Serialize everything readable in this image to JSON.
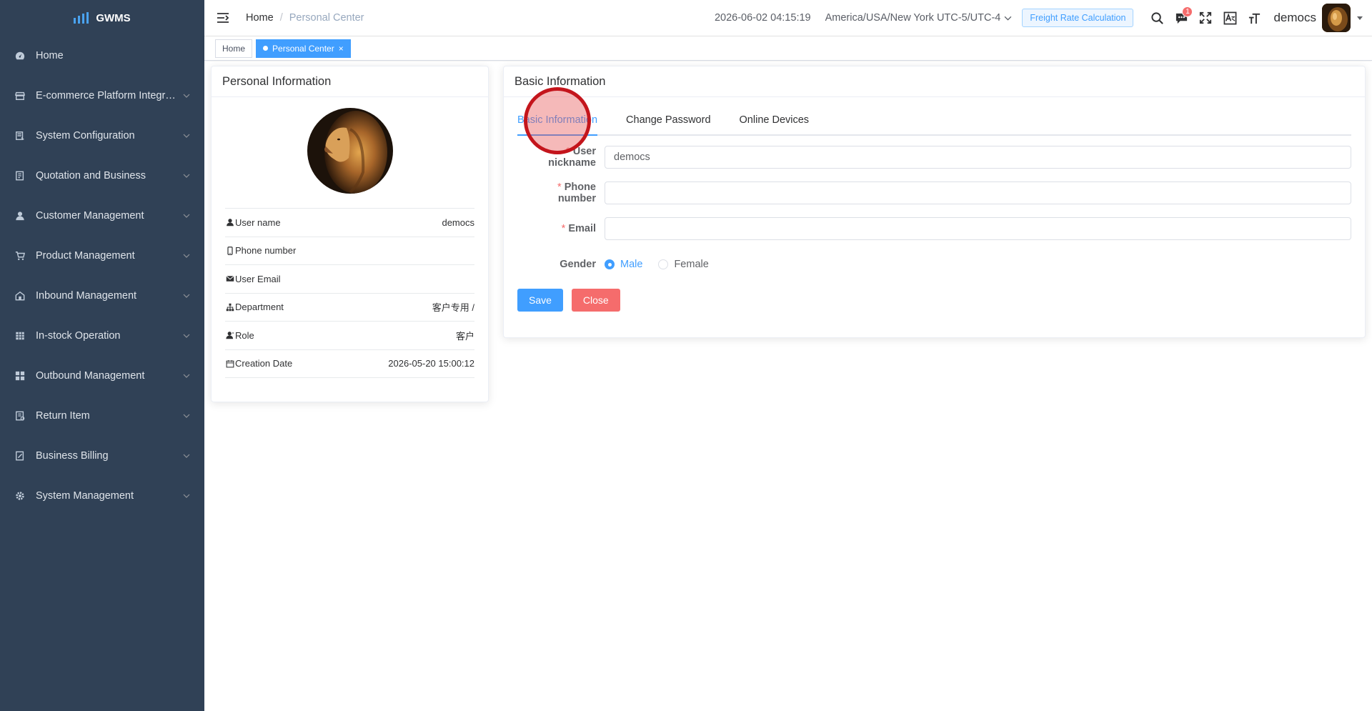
{
  "app": {
    "name": "GWMS"
  },
  "sidebar": {
    "items": [
      {
        "label": "Home",
        "icon": "dashboard-icon",
        "has_arrow": false
      },
      {
        "label": "E-commerce Platform Integr…",
        "icon": "shop-icon",
        "has_arrow": true
      },
      {
        "label": "System Configuration",
        "icon": "config-icon",
        "has_arrow": true
      },
      {
        "label": "Quotation and Business",
        "icon": "document-icon",
        "has_arrow": true
      },
      {
        "label": "Customer Management",
        "icon": "user-icon",
        "has_arrow": true
      },
      {
        "label": "Product Management",
        "icon": "cart-icon",
        "has_arrow": true
      },
      {
        "label": "Inbound Management",
        "icon": "warehouse-icon",
        "has_arrow": true
      },
      {
        "label": "In-stock Operation",
        "icon": "table-icon",
        "has_arrow": true
      },
      {
        "label": "Outbound Management",
        "icon": "grid-icon",
        "has_arrow": true
      },
      {
        "label": "Return Item",
        "icon": "return-icon",
        "has_arrow": true
      },
      {
        "label": "Business Billing",
        "icon": "bill-icon",
        "has_arrow": true
      },
      {
        "label": "System Management",
        "icon": "gear-icon",
        "has_arrow": true
      }
    ]
  },
  "header": {
    "breadcrumb": {
      "home": "Home",
      "separator": "/",
      "current": "Personal Center"
    },
    "datetime": "2026-06-02 04:15:19",
    "timezone": "America/USA/New York UTC-5/UTC-4",
    "freight_button": "Freight Rate Calculation",
    "notification_count": "1",
    "username": "democs"
  },
  "tags": {
    "home": "Home",
    "active": "Personal Center",
    "close_symbol": "×"
  },
  "personal_info": {
    "title": "Personal Information",
    "rows": [
      {
        "label": "User name",
        "value": "democs",
        "icon": "user-icon"
      },
      {
        "label": "Phone number",
        "value": "",
        "icon": "phone-icon"
      },
      {
        "label": "User Email",
        "value": "",
        "icon": "email-icon"
      },
      {
        "label": "Department",
        "value": "客户专用 /",
        "icon": "tree-icon"
      },
      {
        "label": "Role",
        "value": "客户",
        "icon": "role-icon"
      },
      {
        "label": "Creation Date",
        "value": "2026-05-20 15:00:12",
        "icon": "calendar-icon"
      }
    ]
  },
  "basic_info": {
    "title": "Basic Information",
    "tabs": [
      "Basic Information",
      "Change Password",
      "Online Devices"
    ],
    "active_tab": 0,
    "form": {
      "nickname": {
        "label": "User nickname",
        "value": "democs",
        "required": true
      },
      "phone": {
        "label": "Phone number",
        "value": "",
        "required": true
      },
      "email": {
        "label": "Email",
        "value": "",
        "required": true
      },
      "gender": {
        "label": "Gender",
        "options": [
          "Male",
          "Female"
        ],
        "selected": "Male"
      }
    },
    "buttons": {
      "save": "Save",
      "close": "Close"
    }
  },
  "colors": {
    "sidebar_bg": "#304156",
    "primary": "#409eff",
    "danger": "#f56c6c",
    "click_marker": "#c4151c"
  }
}
